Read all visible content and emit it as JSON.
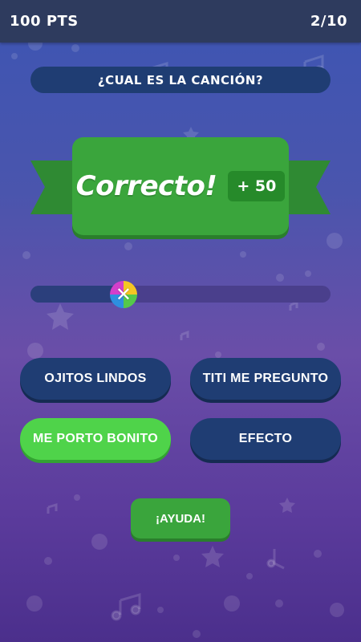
{
  "topbar": {
    "score": "100 PTS",
    "progress": "2/10"
  },
  "question": "¿CUAL ES LA CANCIÓN?",
  "result": {
    "title": "Correcto!",
    "points": "+ 50"
  },
  "progress_bar": {
    "value": 0.31,
    "knob_symbol": "✕"
  },
  "answers": [
    {
      "label": "OJITOS LINDOS",
      "state": "default"
    },
    {
      "label": "TITI ME PREGUNTO",
      "state": "default"
    },
    {
      "label": "ME PORTO BONITO",
      "state": "correct"
    },
    {
      "label": "EFECTO",
      "state": "default"
    }
  ],
  "help_button": "¡AYUDA!",
  "colors": {
    "topbar": "#2e3b5e",
    "panel": "#1f3d73",
    "green": "#3aa53c",
    "correct_green": "#4fd34a"
  }
}
